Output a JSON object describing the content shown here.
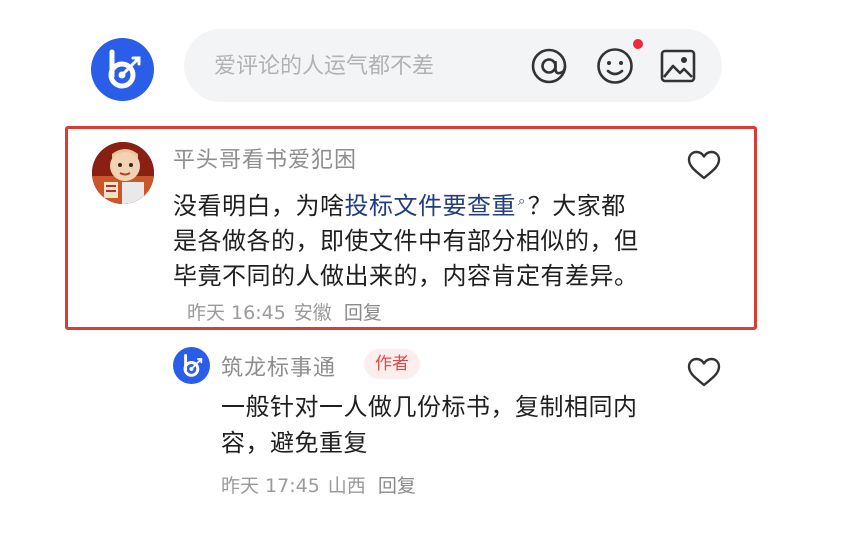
{
  "composer": {
    "placeholder": "爱评论的人运气都不差",
    "icons": [
      "at-icon",
      "emoji-icon",
      "image-icon"
    ],
    "has_notification_dot": true
  },
  "comment": {
    "author": "平头哥看书爱犯困",
    "text_before": "没看明白，为啥",
    "link_text": "投标文件要查重",
    "text_after": "？大家都是各做各的，即使文件中有部分相似的，但毕竟不同的人做出来的，内容肯定有差异。",
    "time": "昨天 16:45",
    "location": "安徽",
    "reply_label": "回复"
  },
  "reply": {
    "author": "筑龙标事通",
    "badge": "作者",
    "text": "一般针对一人做几份标书，复制相同内容，避免重复",
    "time": "昨天 17:45",
    "location": "山西",
    "reply_label": "回复"
  },
  "colors": {
    "brand_blue": "#2a5ee8",
    "highlight_red": "#db3c33",
    "link_blue": "#233e7e",
    "badge_red": "#e04848"
  }
}
